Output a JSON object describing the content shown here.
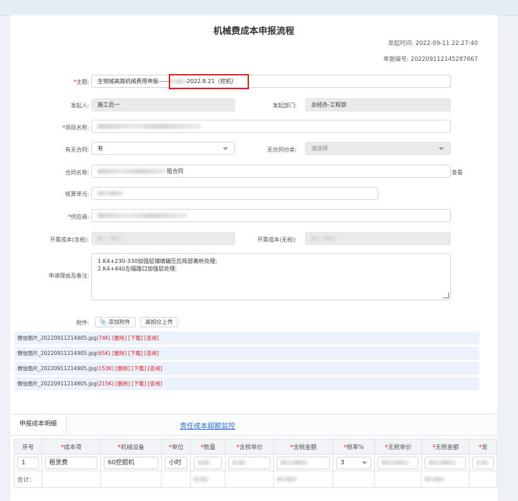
{
  "title": "机械费成本申报流程",
  "meta": {
    "time_label": "发起时间:",
    "time_value": "2022-09-11 22:27:40",
    "no_label": "单据编号:",
    "no_value": "202209112145287667"
  },
  "form": {
    "subject": {
      "label": "主题:",
      "value_a": "生物城高路机械费用申报——",
      "value_b": "-2022.8.21（挖机）"
    },
    "initiator": {
      "label": "发起人:",
      "value": "施工员一"
    },
    "department": {
      "label": "发起部门:",
      "value": "总经办-工程部"
    },
    "project": {
      "label": "项目名称:"
    },
    "has_contract": {
      "label": "有无合同:",
      "value": "有"
    },
    "no_contract_cat": {
      "label": "无合同分类:",
      "placeholder": "请选择"
    },
    "contract_name": {
      "label": "合同名称:",
      "value_suffix": "租合同",
      "view_label": "查看"
    },
    "account_unit": {
      "label": "核算单元:"
    },
    "supplier": {
      "label": "供应商:"
    },
    "cost_incl": {
      "label": "开票成本(含税):"
    },
    "cost_excl": {
      "label": "开票成本(无税):"
    },
    "remarks": {
      "label": "申请理由及备注:",
      "line1": "1.K4+230-330加强层铺填碾压后局部离析处理;",
      "line2": "2.K4+440左幅路口加强层处理;"
    },
    "attachment": {
      "label": "附件:",
      "add_label": "添加附件",
      "scan_label": "高拍仪上传"
    }
  },
  "files": [
    {
      "name": "微信图片_20220911214905.jpg",
      "size": "(74K)",
      "del": "[删除]",
      "down": "[下载]",
      "view": "[查阅]"
    },
    {
      "name": "微信图片_20220911214905.jpg",
      "size": "(65K)",
      "del": "[删除]",
      "down": "[下载]",
      "view": "[查阅]"
    },
    {
      "name": "微信图片_20220911214905.jpg",
      "size": "(153K)",
      "del": "[删除]",
      "down": "[下载]",
      "view": "[查阅]"
    },
    {
      "name": "微信图片_20220911214905.jpg",
      "size": "(215K)",
      "del": "[删除]",
      "down": "[下载]",
      "view": "[查阅]"
    }
  ],
  "detail": {
    "tab_label": "申报成本明细",
    "monitor_link": "责任成本超额监控",
    "headers": {
      "seq": "序号",
      "cost_item": "成本项",
      "machine": "机械设备",
      "unit": "单位",
      "qty": "数量",
      "unit_price_tax": "含税单价",
      "amount_tax": "含税金额",
      "tax_rate": "税率%",
      "unit_price_notax": "无税单价",
      "amount_notax": "无税金额",
      "invoice": "发"
    },
    "row": {
      "seq": "1",
      "cost_item": "租赁费",
      "machine": "60挖掘机",
      "unit": "小时",
      "tax_rate": "3"
    },
    "total_label": "合计:"
  }
}
